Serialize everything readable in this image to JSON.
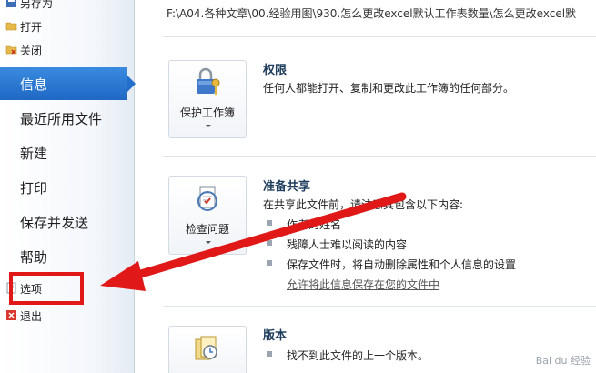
{
  "nav": {
    "save_as": "另存为",
    "open": "打开",
    "close": "关闭",
    "info": "信息",
    "recent": "最近所用文件",
    "new": "新建",
    "print": "打印",
    "save_send": "保存并发送",
    "help": "帮助",
    "options": "选项",
    "exit": "退出"
  },
  "file_path": "F:\\A04.各种文章\\00.经验用图\\930.怎么更改excel默认工作表数量\\怎么更改excel默",
  "permissions": {
    "button": "保护工作簿",
    "title": "权限",
    "text": "任何人都能打开、复制和更改此工作簿的任何部分。"
  },
  "prepare": {
    "button": "检查问题",
    "title": "准备共享",
    "intro": "在共享此文件前，请注意其包含以下内容:",
    "items": [
      "作者的姓名",
      "残障人士难以阅读的内容",
      "保存文件时，将自动删除属性和个人信息的设置"
    ],
    "link": "允许将此信息保存在您的文件中"
  },
  "versions": {
    "title": "版本",
    "text": "找不到此文件的上一个版本。"
  },
  "colors": {
    "active": "#2270cc",
    "highlight": "#e11818"
  },
  "watermark": "Bai du 经验"
}
